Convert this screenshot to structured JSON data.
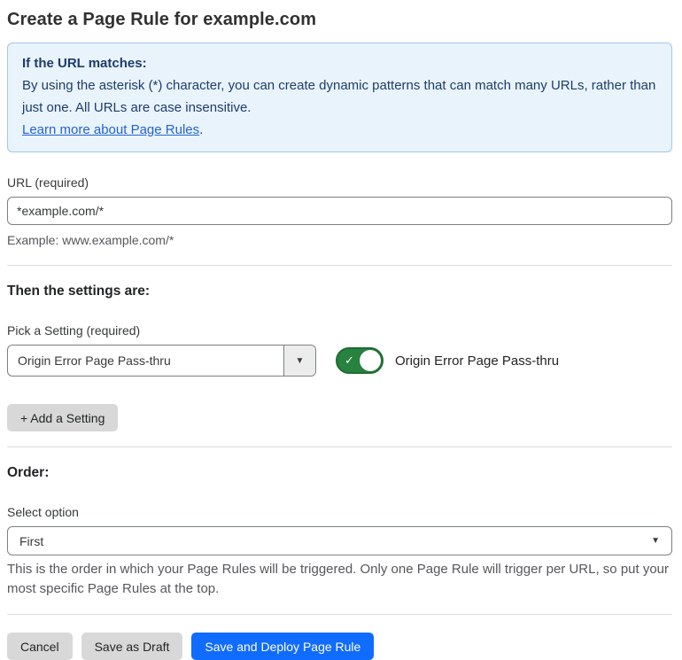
{
  "page": {
    "title": "Create a Page Rule for example.com"
  },
  "info_box": {
    "heading": "If the URL matches:",
    "body": "By using the asterisk (*) character, you can create dynamic patterns that can match many URLs, rather than just one. All URLs are case insensitive.",
    "link": "Learn more about Page Rules",
    "link_suffix": "."
  },
  "url_field": {
    "label": "URL (required)",
    "value": "*example.com/*",
    "helper": "Example: www.example.com/*"
  },
  "settings_section": {
    "heading": "Then the settings are:",
    "pick_label": "Pick a Setting (required)",
    "dropdown_value": "Origin Error Page Pass-thru",
    "toggle_label": "Origin Error Page Pass-thru",
    "toggle_state": "on",
    "add_button": "+ Add a Setting"
  },
  "order_section": {
    "heading": "Order:",
    "select_label": "Select option",
    "select_value": "First",
    "helper": "This is the order in which your Page Rules will be triggered. Only one Page Rule will trigger per URL, so put your most specific Page Rules at the top."
  },
  "footer": {
    "cancel": "Cancel",
    "save_draft": "Save as Draft",
    "save_deploy": "Save and Deploy Page Rule"
  },
  "icons": {
    "chevron_down": "▼",
    "check": "✓"
  },
  "colors": {
    "accent_blue": "#106bff",
    "info_background": "#e9f3fc",
    "info_border": "#a3c7ec",
    "info_text": "#1d3d6b",
    "link_blue": "#2364cf",
    "toggle_green": "#27813f",
    "button_gray": "#d8d8d8"
  }
}
